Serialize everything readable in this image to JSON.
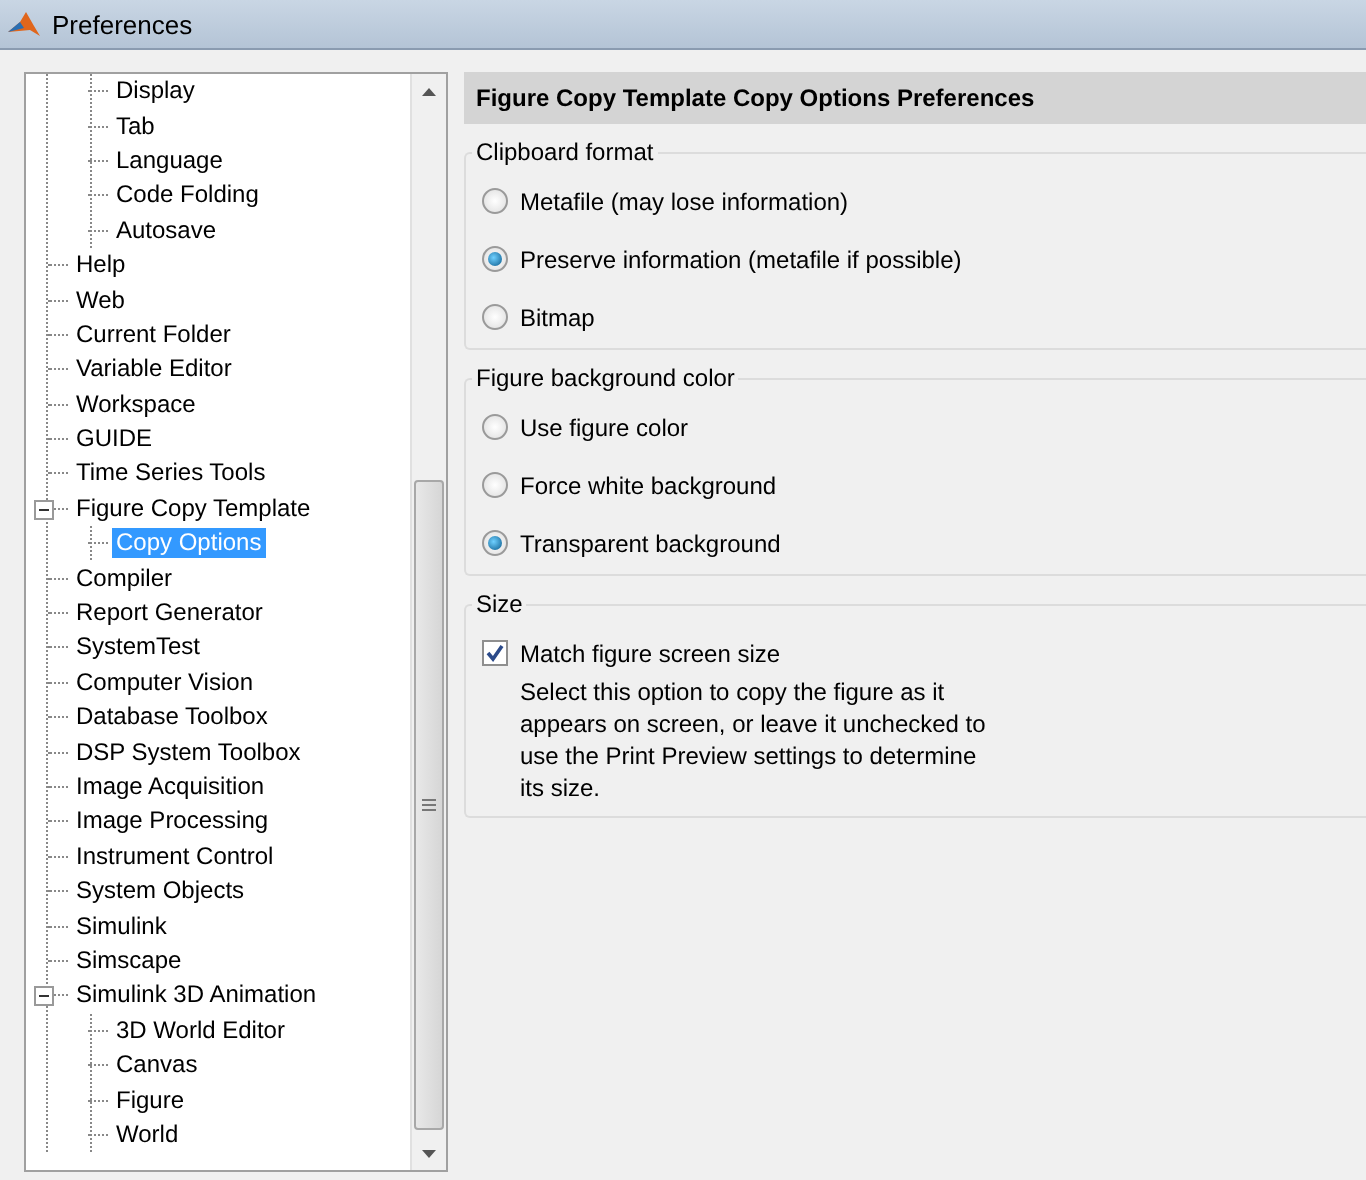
{
  "window": {
    "title": "Preferences"
  },
  "tree": {
    "items": [
      {
        "children": [
          {
            "label": "Display",
            "selected": false
          },
          {
            "label": "Tab",
            "selected": false
          },
          {
            "label": "Language",
            "selected": false
          },
          {
            "label": "Code Folding",
            "selected": false
          },
          {
            "label": "Autosave",
            "selected": false
          }
        ]
      },
      {
        "label": "Help",
        "selected": false
      },
      {
        "label": "Web",
        "selected": false
      },
      {
        "label": "Current Folder",
        "selected": false
      },
      {
        "label": "Variable Editor",
        "selected": false
      },
      {
        "label": "Workspace",
        "selected": false
      },
      {
        "label": "GUIDE",
        "selected": false
      },
      {
        "label": "Time Series Tools",
        "selected": false
      },
      {
        "label": "Figure Copy Template",
        "selected": false,
        "expanded": true,
        "children": [
          {
            "label": "Copy Options",
            "selected": true
          }
        ]
      },
      {
        "label": "Compiler",
        "selected": false
      },
      {
        "label": "Report Generator",
        "selected": false
      },
      {
        "label": "SystemTest",
        "selected": false
      },
      {
        "label": "Computer Vision",
        "selected": false
      },
      {
        "label": "Database Toolbox",
        "selected": false
      },
      {
        "label": "DSP System Toolbox",
        "selected": false
      },
      {
        "label": "Image Acquisition",
        "selected": false
      },
      {
        "label": "Image Processing",
        "selected": false
      },
      {
        "label": "Instrument Control",
        "selected": false
      },
      {
        "label": "System Objects",
        "selected": false
      },
      {
        "label": "Simulink",
        "selected": false
      },
      {
        "label": "Simscape",
        "selected": false
      },
      {
        "label": "Simulink 3D Animation",
        "selected": false,
        "expanded": true,
        "children": [
          {
            "label": "3D World Editor",
            "selected": false
          },
          {
            "label": "Canvas",
            "selected": false
          },
          {
            "label": "Figure",
            "selected": false
          },
          {
            "label": "World",
            "selected": false
          }
        ]
      }
    ]
  },
  "panel": {
    "title": "Figure Copy Template Copy Options Preferences",
    "groups": [
      {
        "title": "Clipboard format",
        "options": [
          {
            "kind": "radio",
            "label": "Metafile (may lose information)",
            "selected": false
          },
          {
            "kind": "radio",
            "label": "Preserve information (metafile if possible)",
            "selected": true
          },
          {
            "kind": "radio",
            "label": "Bitmap",
            "selected": false
          }
        ]
      },
      {
        "title": "Figure background color",
        "options": [
          {
            "kind": "radio",
            "label": "Use figure color",
            "selected": false
          },
          {
            "kind": "radio",
            "label": "Force white background",
            "selected": false
          },
          {
            "kind": "radio",
            "label": "Transparent background",
            "selected": true
          }
        ]
      },
      {
        "title": "Size",
        "options": [
          {
            "kind": "checkbox",
            "label": "Match figure screen size",
            "checked": true,
            "description": "Select this option to copy the figure as it appears on screen, or leave it unchecked to use the Print Preview settings to determine its size."
          }
        ]
      }
    ]
  }
}
